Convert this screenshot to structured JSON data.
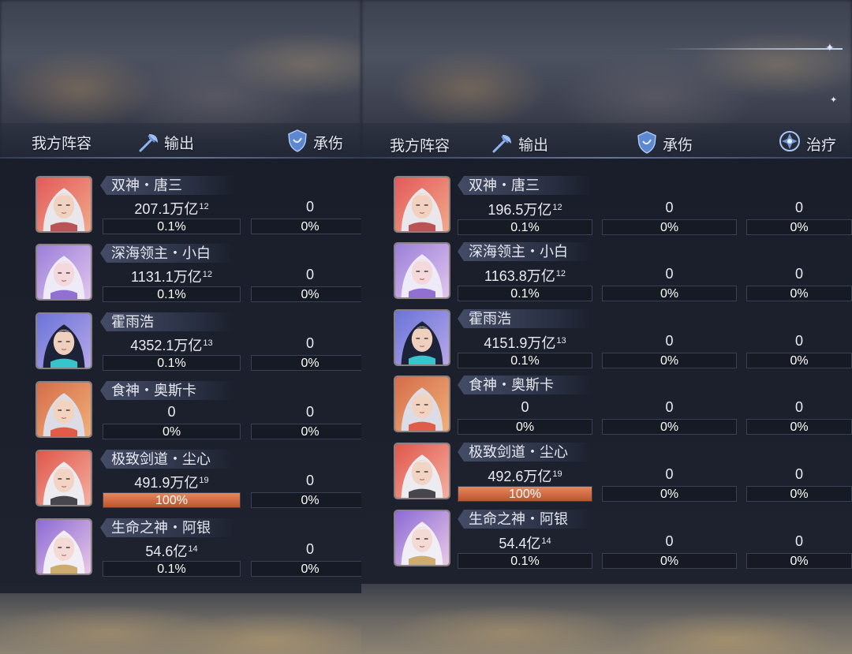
{
  "screens": [
    {
      "header": {
        "title": "我方阵容",
        "columns": [
          {
            "label": "输出",
            "icon": "axe-icon"
          },
          {
            "label": "承伤",
            "icon": "shield-icon"
          }
        ]
      },
      "heroes": [
        {
          "name": "双神・唐三",
          "avatar": "tang-san-portrait",
          "damage": "207.1万亿",
          "damage_power": "12",
          "damage_share": 0.001,
          "damage_pct": "0.1%",
          "taken": "0",
          "taken_pct": "0%"
        },
        {
          "name": "深海领主・小白",
          "avatar": "xiao-bai-portrait",
          "damage": "1131.1万亿",
          "damage_power": "12",
          "damage_share": 0.001,
          "damage_pct": "0.1%",
          "taken": "0",
          "taken_pct": "0%"
        },
        {
          "name": "霍雨浩",
          "avatar": "huo-yu-hao-portrait",
          "damage": "4352.1万亿",
          "damage_power": "13",
          "damage_share": 0.001,
          "damage_pct": "0.1%",
          "taken": "0",
          "taken_pct": "0%"
        },
        {
          "name": "食神・奥斯卡",
          "avatar": "oscar-portrait",
          "damage": "0",
          "damage_power": "",
          "damage_share": 0,
          "damage_pct": "0%",
          "taken": "0",
          "taken_pct": "0%"
        },
        {
          "name": "极致剑道・尘心",
          "avatar": "chen-xin-portrait",
          "damage": "491.9万亿",
          "damage_power": "19",
          "damage_share": 1.0,
          "damage_pct": "100%",
          "taken": "0",
          "taken_pct": "0%"
        },
        {
          "name": "生命之神・阿银",
          "avatar": "a-yin-portrait",
          "damage": "54.6亿",
          "damage_power": "14",
          "damage_share": 0.001,
          "damage_pct": "0.1%",
          "taken": "0",
          "taken_pct": "0%"
        }
      ]
    },
    {
      "header": {
        "title": "我方阵容",
        "columns": [
          {
            "label": "输出",
            "icon": "axe-icon"
          },
          {
            "label": "承伤",
            "icon": "shield-icon"
          },
          {
            "label": "治疗",
            "icon": "heal-cross-icon"
          }
        ]
      },
      "heroes": [
        {
          "name": "双神・唐三",
          "avatar": "tang-san-portrait",
          "damage": "196.5万亿",
          "damage_power": "12",
          "damage_share": 0.001,
          "damage_pct": "0.1%",
          "taken": "0",
          "taken_pct": "0%",
          "heal": "0",
          "heal_pct": "0%"
        },
        {
          "name": "深海领主・小白",
          "avatar": "xiao-bai-portrait",
          "damage": "1163.8万亿",
          "damage_power": "12",
          "damage_share": 0.001,
          "damage_pct": "0.1%",
          "taken": "0",
          "taken_pct": "0%",
          "heal": "0",
          "heal_pct": "0%"
        },
        {
          "name": "霍雨浩",
          "avatar": "huo-yu-hao-portrait",
          "damage": "4151.9万亿",
          "damage_power": "13",
          "damage_share": 0.001,
          "damage_pct": "0.1%",
          "taken": "0",
          "taken_pct": "0%",
          "heal": "0",
          "heal_pct": "0%"
        },
        {
          "name": "食神・奥斯卡",
          "avatar": "oscar-portrait",
          "damage": "0",
          "damage_power": "",
          "damage_share": 0,
          "damage_pct": "0%",
          "taken": "0",
          "taken_pct": "0%",
          "heal": "0",
          "heal_pct": "0%"
        },
        {
          "name": "极致剑道・尘心",
          "avatar": "chen-xin-portrait",
          "damage": "492.6万亿",
          "damage_power": "19",
          "damage_share": 1.0,
          "damage_pct": "100%",
          "taken": "0",
          "taken_pct": "0%",
          "heal": "0",
          "heal_pct": "0%"
        },
        {
          "name": "生命之神・阿银",
          "avatar": "a-yin-portrait",
          "damage": "54.4亿",
          "damage_power": "14",
          "damage_share": 0.001,
          "damage_pct": "0.1%",
          "taken": "0",
          "taken_pct": "0%",
          "heal": "0",
          "heal_pct": "0%"
        }
      ]
    }
  ],
  "colors": {
    "bar_fill": "#d46e48",
    "panel_bg": "#1e2230",
    "text": "#e9ebf2"
  }
}
